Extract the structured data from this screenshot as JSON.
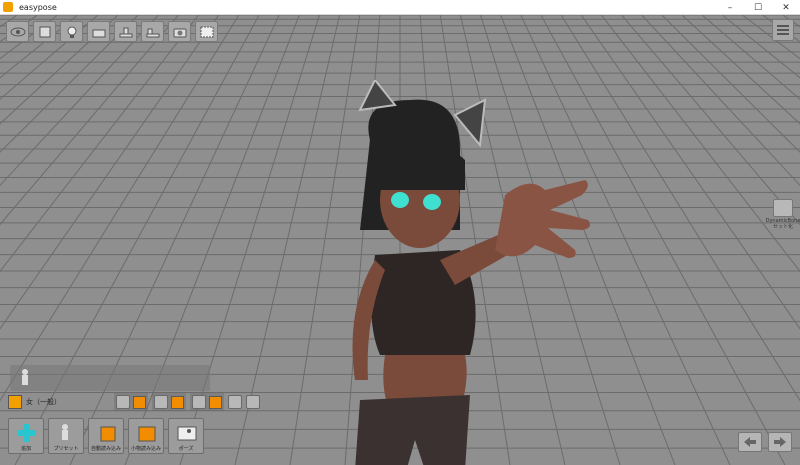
{
  "window": {
    "title": "easypose",
    "controls": [
      "–",
      "☐",
      "✕"
    ]
  },
  "toolbar": {
    "icons": [
      "eye-icon",
      "cube-icon",
      "light-icon",
      "camera-move-icon",
      "floor-icon",
      "ground-icon",
      "camera-icon",
      "screenshot-icon"
    ]
  },
  "right_panel": {
    "menu_icon": "layers-icon",
    "side_button_label": "DynamicBone\nセット化"
  },
  "character_controls": {
    "name": "女（一般）"
  },
  "bottom_buttons": [
    {
      "label": "追加",
      "icon": "add-icon"
    },
    {
      "label": "プリセット",
      "icon": "preset-icon"
    },
    {
      "label": "自動読み込み",
      "icon": "auto-load-icon"
    },
    {
      "label": "小物読み込み",
      "icon": "item-load-icon"
    },
    {
      "label": "ポーズ",
      "icon": "pose-icon"
    }
  ],
  "navigation": {
    "prev_icon": "arrow-left-icon",
    "next_icon": "arrow-right-icon"
  },
  "colors": {
    "accent": "#f28c00",
    "background": "#8f8f8f",
    "grid": "#6a6a6a"
  }
}
